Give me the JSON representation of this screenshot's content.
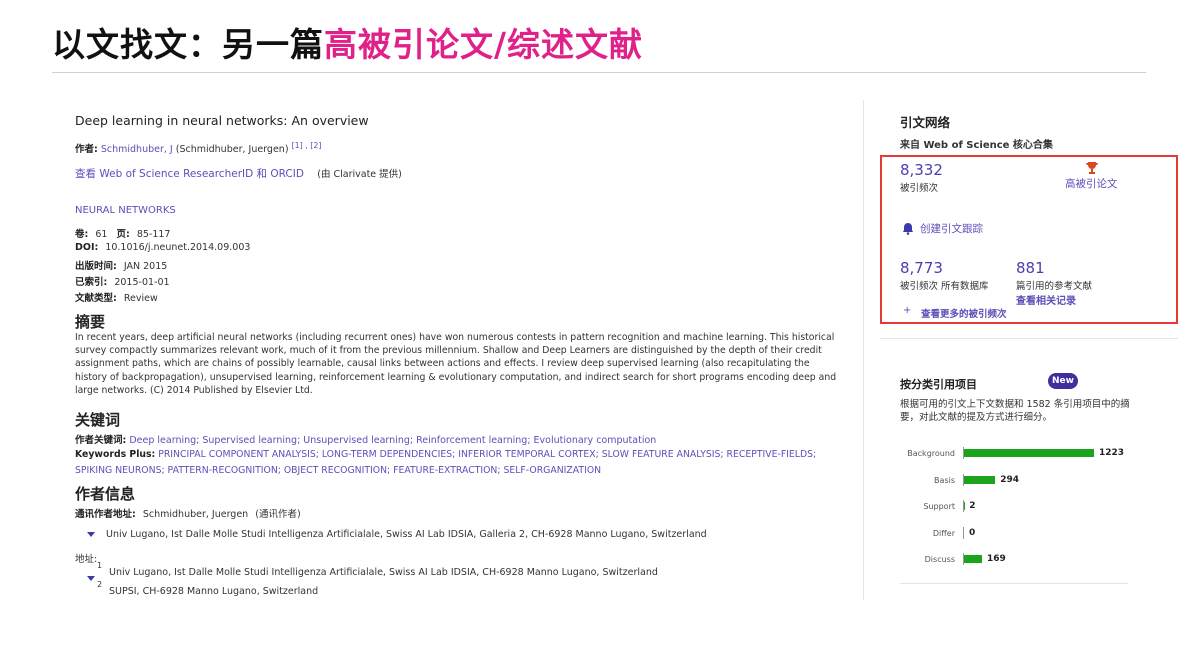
{
  "slide_title": {
    "prefix": "以文找文：另一篇",
    "highlight": "高被引论文/综述文献"
  },
  "article": {
    "title": "Deep learning in neural networks: An overview",
    "author_label": "作者:",
    "author_name": "Schmidhuber, J",
    "author_full": "(Schmidhuber, Juergen)",
    "author_refs": "[1] , [2]",
    "researcher_link": "查看 Web of Science ResearcherID 和 ORCID",
    "researcher_provider": "(由 Clarivate 提供)",
    "journal": "NEURAL NETWORKS",
    "volume_label": "卷:",
    "volume": "61",
    "pages_label": "页:",
    "pages": "85-117",
    "doi_label": "DOI:",
    "doi": "10.1016/j.neunet.2014.09.003",
    "pubdate_label": "出版时间:",
    "pubdate": "JAN 2015",
    "indexed_label": "已索引:",
    "indexed": "2015-01-01",
    "doctype_label": "文献类型:",
    "doctype": "Review"
  },
  "abstract": {
    "heading": "摘要",
    "text": "In recent years, deep artificial neural networks (including recurrent ones) have won numerous contests in pattern recognition and machine learning. This historical survey compactly summarizes relevant work, much of it from the previous millennium. Shallow and Deep Learners are distinguished by the depth of their credit assignment paths, which are chains of possibly learnable, causal links between actions and effects. I review deep supervised learning (also recapitulating the history of backpropagation), unsupervised learning, reinforcement learning & evolutionary computation, and indirect search for short programs encoding deep and large networks. (C) 2014 Published by Elsevier Ltd."
  },
  "keywords": {
    "heading": "关键词",
    "author_kw_label": "作者关键词:",
    "author_kw": "Deep learning; Supervised learning; Unsupervised learning; Reinforcement learning; Evolutionary computation",
    "plus_label": "Keywords Plus:",
    "plus": "PRINCIPAL COMPONENT ANALYSIS; LONG-TERM DEPENDENCIES; INFERIOR TEMPORAL CORTEX; SLOW FEATURE ANALYSIS; RECEPTIVE-FIELDS; SPIKING NEURONS; PATTERN-RECOGNITION; OBJECT RECOGNITION; FEATURE-EXTRACTION; SELF-ORGANIZATION"
  },
  "author_info": {
    "heading": "作者信息",
    "corr_label": "通讯作者地址:",
    "corr_name": "Schmidhuber, Juergen",
    "corr_note": "(通讯作者)",
    "corr_address": "Univ Lugano, Ist Dalle Molle Studi Intelligenza Artificialale, Swiss AI Lab IDSIA, Galleria 2, CH-6928 Manno Lugano, Switzerland",
    "addr_label": "地址:",
    "addr1_num": "1",
    "addr1": "Univ Lugano, Ist Dalle Molle Studi Intelligenza Artificialale, Swiss AI Lab IDSIA, CH-6928 Manno Lugano, Switzerland",
    "addr2_num": "2",
    "addr2": "SUPSI, CH-6928 Manno Lugano, Switzerland"
  },
  "citation_network": {
    "title": "引文网络",
    "source": "来自 Web of Science 核心合集",
    "times_cited": "8,332",
    "times_cited_label": "被引频次",
    "highly_cited_label": "高被引论文",
    "create_alert": "创建引文跟踪",
    "all_db_count": "8,773",
    "all_db_label": "被引频次 所有数据库",
    "refs_count": "881",
    "refs_label": "篇引用的参考文献",
    "related_records": "查看相关记录",
    "more_counts": "查看更多的被引频次"
  },
  "classification": {
    "title": "按分类引用项目",
    "badge": "New",
    "desc": "根据可用的引文上下文数据和 1582 条引用项目中的摘要，对此文献的提及方式进行细分。"
  },
  "chart_data": {
    "type": "bar",
    "orientation": "horizontal",
    "categories": [
      "Background",
      "Basis",
      "Support",
      "Differ",
      "Discuss"
    ],
    "values": [
      1223,
      294,
      2,
      0,
      169
    ],
    "bar_color": "#1ca31c"
  },
  "colors": {
    "highlight": "#e0218a",
    "link": "#5b4fb8",
    "box": "#e53935",
    "badge": "#3f2f9e"
  }
}
